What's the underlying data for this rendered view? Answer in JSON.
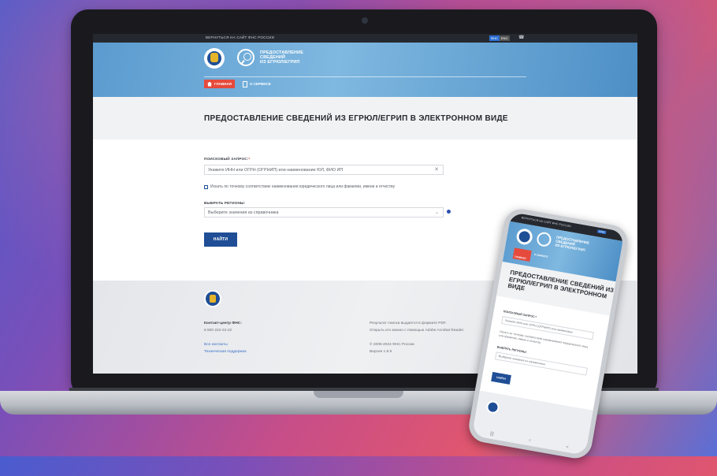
{
  "colors": {
    "accent_red": "#e64a3c",
    "brand_blue": "#1f4e96",
    "header_blue": "#5b9bcf"
  },
  "topbar": {
    "back_link": "ВЕРНУТЬСЯ НА САЙТ ФНС РОССИИ",
    "lang_ru": "ФНС",
    "lang_en": "ENG",
    "phone_icon": "☎"
  },
  "header": {
    "service_title_1": "ПРЕДОСТАВЛЕНИЕ",
    "service_title_2": "СВЕДЕНИЙ",
    "service_title_3": "ИЗ ЕГРЮЛ/ЕГРИП"
  },
  "nav": {
    "home": "ГЛАВНАЯ",
    "about": "О СЕРВИСЕ"
  },
  "page": {
    "title": "ПРЕДОСТАВЛЕНИЕ СВЕДЕНИЙ ИЗ ЕГРЮЛ/ЕГРИП В ЭЛЕКТРОННОМ ВИДЕ"
  },
  "form": {
    "query_label": "ПОИСКОВЫЙ ЗАПРОС:",
    "query_required": "*",
    "query_placeholder": "Укажите ИНН или ОГРН (ОГРНИП) или наименование ЮЛ, ФИО ИП",
    "clear_icon": "✕",
    "exact_match_label": "Искать по точному соответствию наименования юридического лица или фамилии, имени и отчеству",
    "regions_label": "ВЫБРАТЬ РЕГИОНЫ:",
    "regions_placeholder": "Выберите значения из справочника",
    "chevron": "⌄",
    "submit": "НАЙТИ"
  },
  "footer": {
    "contact_title": "Контакт-центр ФНС:",
    "contact_phone": "8 800 222-22-22",
    "all_contacts": "Все контакты",
    "support": "Техническая поддержка",
    "result_note_1": "Результат поиска выдается в формате PDF.",
    "result_note_2": "Открыть его можно с помощью Adobe Acrobat Reader.",
    "copyright": "© 2005-2024 ФНС России",
    "version": "Версия 1.8.9"
  },
  "phone": {
    "back_link": "ВЕРНУТЬСЯ НА САЙТ ФНС РОССИИ",
    "lang": "ENG",
    "title_1": "ПРЕДОСТАВЛЕНИЕ",
    "title_2": "СВЕДЕНИЙ",
    "title_3": "ИЗ ЕГРЮЛ/ЕГРИП",
    "home": "ГЛАВНАЯ",
    "about": "О СЕРВИСЕ",
    "page_title_1": "ПРЕДОСТАВЛЕНИЕ СВЕДЕНИЙ ИЗ",
    "page_title_2": "ЕГРЮЛ/ЕГРИП В ЭЛЕКТРОННОМ",
    "page_title_3": "ВИДЕ",
    "query_label": "ПОИСКОВЫЙ ЗАПРОС:*",
    "query_placeholder": "Укажите ИНН или ОГРН (ОГРНИП) или наименован",
    "exact_match": "Искать по точному соответствию наименования юридического лица или фамилии, имени и отчеству",
    "regions_label": "ВЫБРАТЬ РЕГИОНЫ:",
    "regions_placeholder": "Выберите значения из справочника",
    "submit": "НАЙТИ",
    "nav_recent": "|||",
    "nav_home": "○",
    "nav_back": "<"
  }
}
